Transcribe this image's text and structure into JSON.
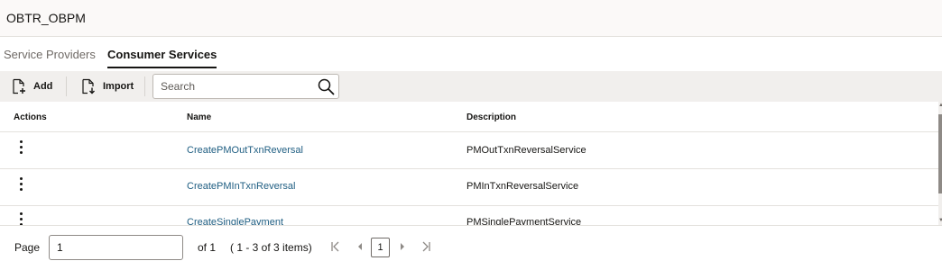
{
  "app": {
    "title": "OBTR_OBPM"
  },
  "tabs": [
    {
      "label": "Service Providers",
      "active": false
    },
    {
      "label": "Consumer Services",
      "active": true
    }
  ],
  "toolbar": {
    "add_label": "Add",
    "import_label": "Import",
    "search_placeholder": "Search",
    "search_value": ""
  },
  "grid": {
    "columns": {
      "actions": "Actions",
      "name": "Name",
      "description": "Description"
    },
    "rows": [
      {
        "name": "CreatePMOutTxnReversal",
        "description": "PMOutTxnReversalService"
      },
      {
        "name": "CreatePMInTxnReversal",
        "description": "PMInTxnReversalService"
      },
      {
        "name": "CreateSinglePayment",
        "description": "PMSinglePaymentService"
      }
    ]
  },
  "pagination": {
    "page_label": "Page",
    "page_value": "1",
    "of_label": "of 1",
    "range_label": "( 1 - 3 of 3 items)",
    "current_page": "1"
  },
  "icons": {
    "add": "add-document-icon",
    "import": "import-document-icon",
    "search": "search-icon",
    "row_action": "kebab-menu-icon",
    "first": "first-page-icon",
    "prev": "previous-page-icon",
    "next": "next-page-icon",
    "last": "last-page-icon"
  },
  "colors": {
    "link": "#1f5e82",
    "toolbar_bg": "#f1efed",
    "titlebar_bg": "#fbf9f8",
    "text": "#161513"
  }
}
